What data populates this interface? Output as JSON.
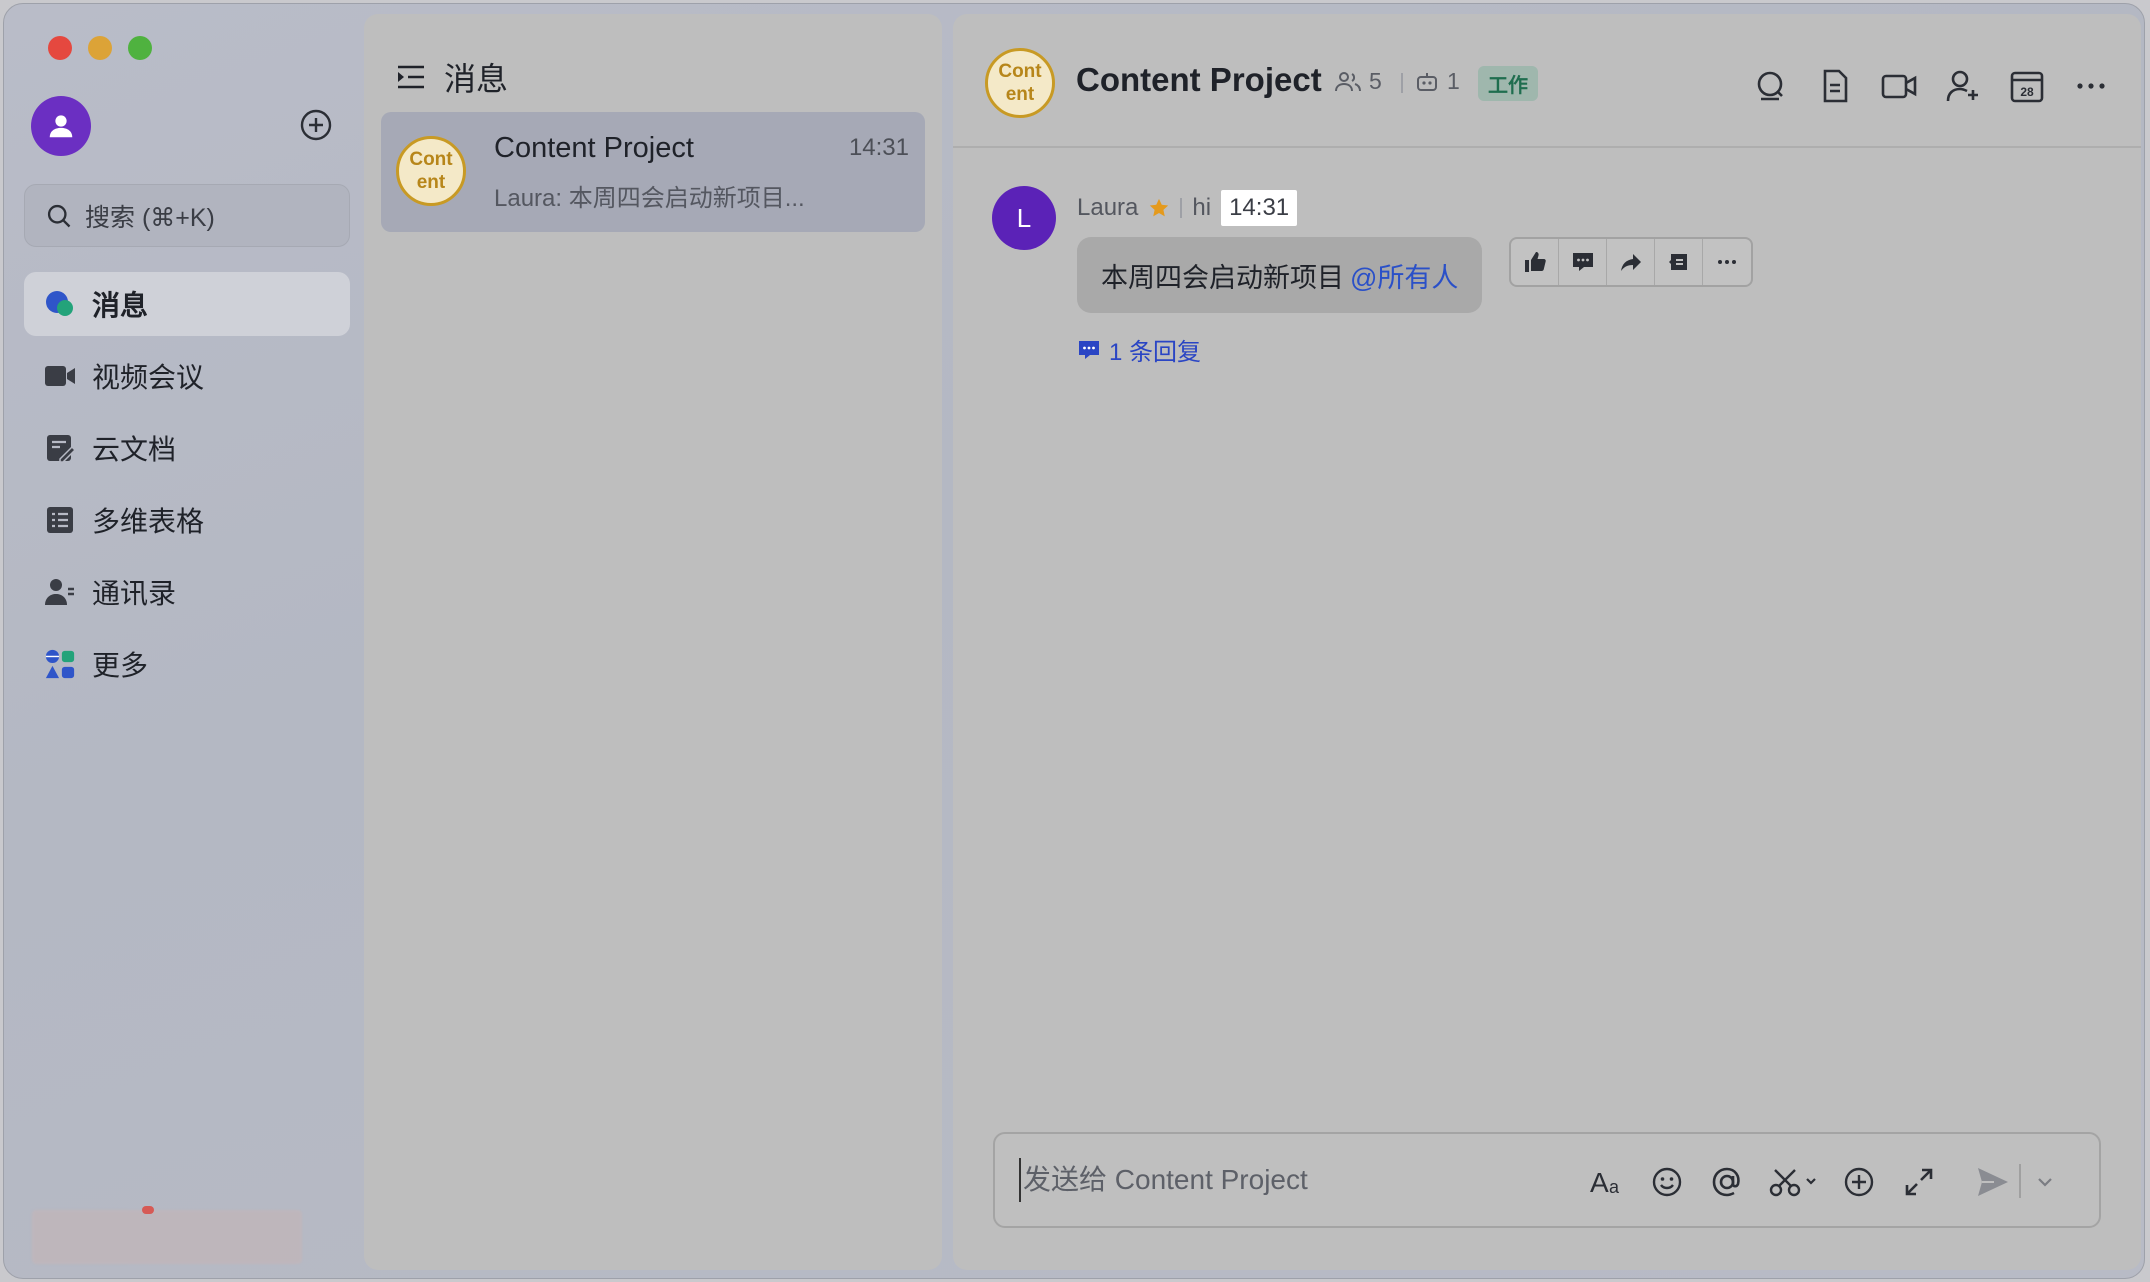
{
  "sidebar": {
    "search_placeholder": "搜索 (⌘+K)",
    "items": [
      {
        "label": "消息",
        "icon": "chat-bubble-icon",
        "active": true
      },
      {
        "label": "视频会议",
        "icon": "video-camera-icon"
      },
      {
        "label": "云文档",
        "icon": "cloud-doc-icon"
      },
      {
        "label": "多维表格",
        "icon": "table-icon"
      },
      {
        "label": "通讯录",
        "icon": "contacts-icon"
      },
      {
        "label": "更多",
        "icon": "apps-grid-icon"
      }
    ]
  },
  "conversation_list": {
    "header": "消息",
    "items": [
      {
        "avatar_text_1": "Cont",
        "avatar_text_2": "ent",
        "title": "Content Project",
        "time": "14:31",
        "preview": "Laura: 本周四会启动新项目..."
      }
    ]
  },
  "chat": {
    "avatar_text_1": "Cont",
    "avatar_text_2": "ent",
    "title": "Content Project",
    "member_count": "5",
    "bot_count": "1",
    "tag": "工作",
    "messages": [
      {
        "avatar_letter": "L",
        "sender": "Laura",
        "status": "hi",
        "time": "14:31",
        "text": "本周四会启动新项目",
        "mention": "@所有人",
        "reply_count_label": "1 条回复"
      }
    ],
    "composer_placeholder": "发送给 Content Project"
  },
  "colors": {
    "accent_purple": "#6b2fc2",
    "group_avatar_gold": "#c89a24",
    "link_blue": "#2a50c8",
    "tag_green": "#1f6e4f"
  }
}
